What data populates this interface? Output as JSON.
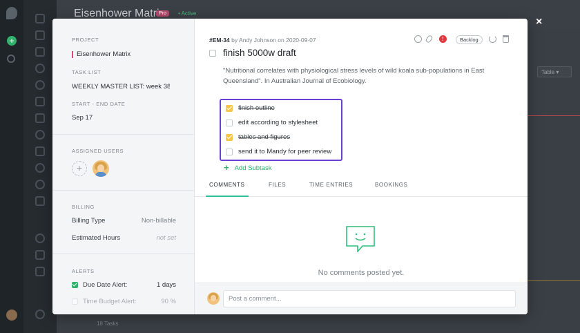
{
  "background": {
    "project_title": "Eisenhower Matrix",
    "badge": "Pro",
    "status": "• Active",
    "view_select": "Table ▾",
    "footer": "18 Tasks"
  },
  "close_label": "×",
  "left_panel": {
    "project_label": "PROJECT",
    "project_value": "Eisenhower Matrix",
    "tasklist_label": "TASK LIST",
    "tasklist_value": "WEEKLY MASTER LIST: week 38",
    "dates_label": "START - END DATE",
    "dates_value": "Sep 17",
    "assigned_label": "ASSIGNED USERS",
    "add_user_symbol": "+",
    "billing_label": "BILLING",
    "billing_type_label": "Billing Type",
    "billing_type_value": "Non-billable",
    "est_hours_label": "Estimated Hours",
    "est_hours_value": "not set",
    "alerts_label": "ALERTS",
    "due_date_alert_label": "Due Date Alert:",
    "due_date_alert_value": "1 days",
    "time_budget_alert_label": "Time Budget Alert:",
    "time_budget_alert_value": "90 %"
  },
  "task": {
    "id": "#EM-34",
    "by_text": "by",
    "author": "Andy Johnson",
    "on_text": "on",
    "date": "2020-09-07",
    "status": "Backlog",
    "title": "finish 5000w draft",
    "description": "\"Nutritional correlates with physiological stress levels of wild koala sub-populations in East Queensland\". In Australian Journal of Ecobiology."
  },
  "subtasks": [
    {
      "label": "finish outline",
      "done": true
    },
    {
      "label": "edit according to stylesheet",
      "done": false
    },
    {
      "label": "tables and figures",
      "done": true
    },
    {
      "label": "send it to Mandy for peer review",
      "done": false
    }
  ],
  "add_subtask_label": "Add Subtask",
  "tabs": [
    {
      "label": "COMMENTS",
      "active": true
    },
    {
      "label": "FILES",
      "active": false
    },
    {
      "label": "TIME ENTRIES",
      "active": false
    },
    {
      "label": "BOOKINGS",
      "active": false
    }
  ],
  "empty_comments": "No comments posted yet.",
  "comment_input": {
    "placeholder": "Post a comment...",
    "value": ""
  },
  "colors": {
    "accent_green": "#2fb36b",
    "tab_underline": "#2fbf9f",
    "subtask_border": "#6a3fd4",
    "check_done": "#f7c64a",
    "alert_red": "#d93a3a"
  }
}
